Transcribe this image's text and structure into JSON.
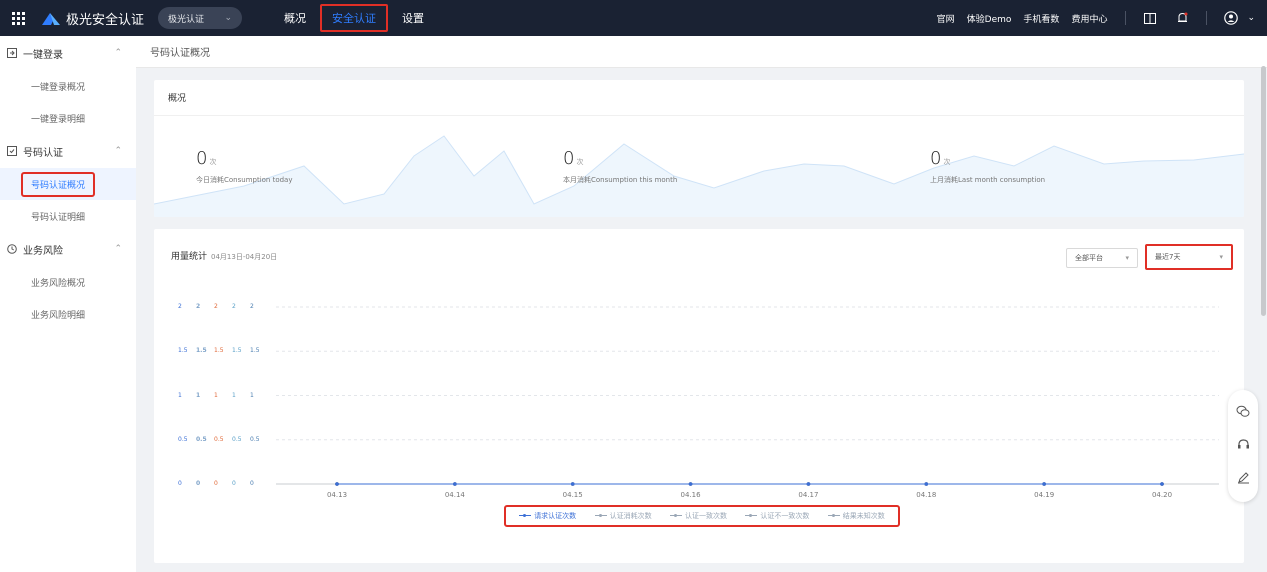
{
  "topbar": {
    "brand": "极光安全认证",
    "product_select": "极光认证",
    "nav": [
      {
        "label": "概况",
        "active": false
      },
      {
        "label": "安全认证",
        "active": true
      },
      {
        "label": "设置",
        "active": false
      }
    ],
    "links": [
      "官网",
      "体验Demo",
      "手机看数",
      "费用中心"
    ]
  },
  "sidebar": {
    "groups": [
      {
        "label": "一键登录",
        "icon": "login-icon",
        "items": [
          {
            "label": "一键登录概况"
          },
          {
            "label": "一键登录明细"
          }
        ]
      },
      {
        "label": "号码认证",
        "icon": "phone-verify-icon",
        "items": [
          {
            "label": "号码认证概况",
            "active": true
          },
          {
            "label": "号码认证明细"
          }
        ]
      },
      {
        "label": "业务风险",
        "icon": "risk-icon",
        "items": [
          {
            "label": "业务风险概况"
          },
          {
            "label": "业务风险明细"
          }
        ]
      }
    ]
  },
  "breadcrumb": "号码认证概况",
  "overview": {
    "title": "概况",
    "metrics": [
      {
        "value": "0",
        "unit": "次",
        "label": "今日消耗Consumption today"
      },
      {
        "value": "0",
        "unit": "次",
        "label": "本月消耗Consumption this month"
      },
      {
        "value": "0",
        "unit": "次",
        "label": "上月消耗Last month consumption"
      }
    ]
  },
  "usage": {
    "title": "用量统计",
    "date_range": "04月13日-04月20日",
    "platform_select": "全部平台",
    "period_select": "最近7天"
  },
  "colors": {
    "accent": "#2f7dff",
    "topbar": "#1a2233",
    "highlight": "#e02f26",
    "series": [
      "#3b6fd6",
      "#7fa3c9",
      "#e06a3a",
      "#5aa0c8",
      "#4a7db0"
    ]
  },
  "chart_data": {
    "type": "line",
    "title": "用量统计",
    "categories": [
      "04.13",
      "04.14",
      "04.15",
      "04.16",
      "04.17",
      "04.18",
      "04.19",
      "04.20"
    ],
    "y_ticks": [
      "0",
      "0.5",
      "1",
      "1.5",
      "2"
    ],
    "ylim": [
      0,
      2
    ],
    "grid": true,
    "legend_position": "bottom",
    "series": [
      {
        "name": "请求认证次数",
        "values": [
          0,
          0,
          0,
          0,
          0,
          0,
          0,
          0
        ]
      },
      {
        "name": "认证消耗次数",
        "values": [
          0,
          0,
          0,
          0,
          0,
          0,
          0,
          0
        ]
      },
      {
        "name": "认证一致次数",
        "values": [
          0,
          0,
          0,
          0,
          0,
          0,
          0,
          0
        ]
      },
      {
        "name": "认证不一致次数",
        "values": [
          0,
          0,
          0,
          0,
          0,
          0,
          0,
          0
        ]
      },
      {
        "name": "结果未知次数",
        "values": [
          0,
          0,
          0,
          0,
          0,
          0,
          0,
          0
        ]
      }
    ]
  }
}
